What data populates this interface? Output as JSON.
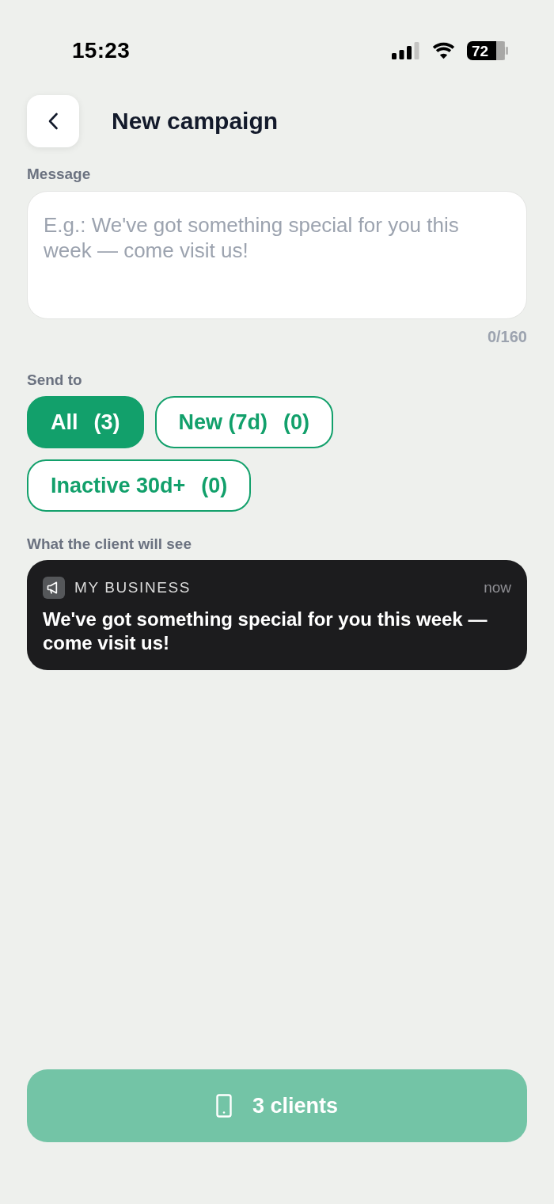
{
  "status_bar": {
    "time": "15:23",
    "battery": "72"
  },
  "header": {
    "title": "New campaign"
  },
  "message": {
    "label": "Message",
    "placeholder": "E.g.: We've got something special for you this week — come visit us!",
    "counter": "0/160"
  },
  "audience": {
    "label": "Send to",
    "options": [
      {
        "label": "All",
        "count": "(3)",
        "selected": true
      },
      {
        "label": "New (7d)",
        "count": "(0)",
        "selected": false
      },
      {
        "label": "Inactive 30d+",
        "count": "(0)",
        "selected": false
      }
    ]
  },
  "preview": {
    "label": "What the client will see",
    "notification": {
      "app_name": "MY BUSINESS",
      "time": "now",
      "body": "We've got something special for you this week — come visit us!"
    }
  },
  "send_button": {
    "label": "3 clients",
    "disabled": true
  }
}
